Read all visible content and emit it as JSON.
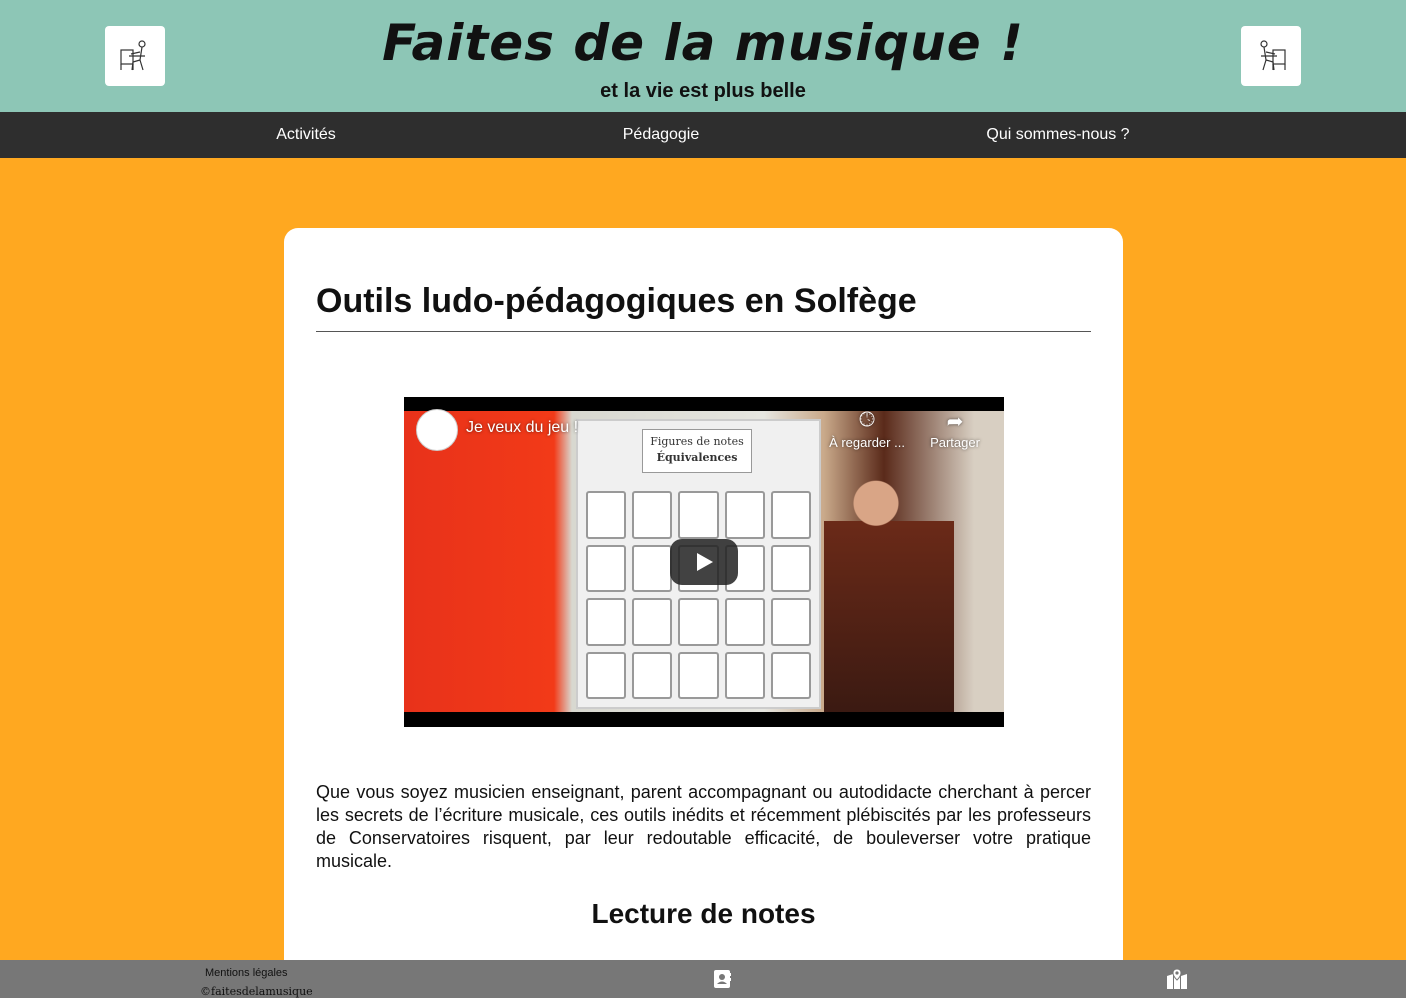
{
  "header": {
    "title": "Faites de la musique !",
    "subtitle": "et la vie est plus belle",
    "logo_left_icon": "pianist-drawing-icon",
    "logo_right_icon": "pianist-drawing-icon",
    "background_color": "#8DC6B6"
  },
  "nav": {
    "items": [
      {
        "label": "Activités"
      },
      {
        "label": "Pédagogie"
      },
      {
        "label": "Qui sommes-nous ?"
      }
    ],
    "background_color": "#2E2E2E"
  },
  "main": {
    "title": "Outils ludo-pédagogiques en Solfège",
    "video": {
      "title": "Je veux du jeu !",
      "watch_later_label": "À regarder ...",
      "share_label": "Partager",
      "board_label_line1": "Figures de notes",
      "board_label_line2": "Équivalences"
    },
    "intro_text": "Que vous soyez musicien enseignant, parent accompagnant ou autodidacte cherchant à percer les secrets de l’écriture musicale, ces outils inédits et récemment plébiscités par les professeurs de Conservatoires risquent, par leur redoutable efficacité, de bouleverser votre pratique musicale.",
    "section_title": "Lecture de notes",
    "background_color": "#FFA820"
  },
  "footer": {
    "legal_label": "Mentions légales",
    "copyright": "©faitesdelamusique",
    "contact_icon": "contact-book-icon",
    "map_icon": "map-location-icon",
    "background_color": "#777777"
  }
}
